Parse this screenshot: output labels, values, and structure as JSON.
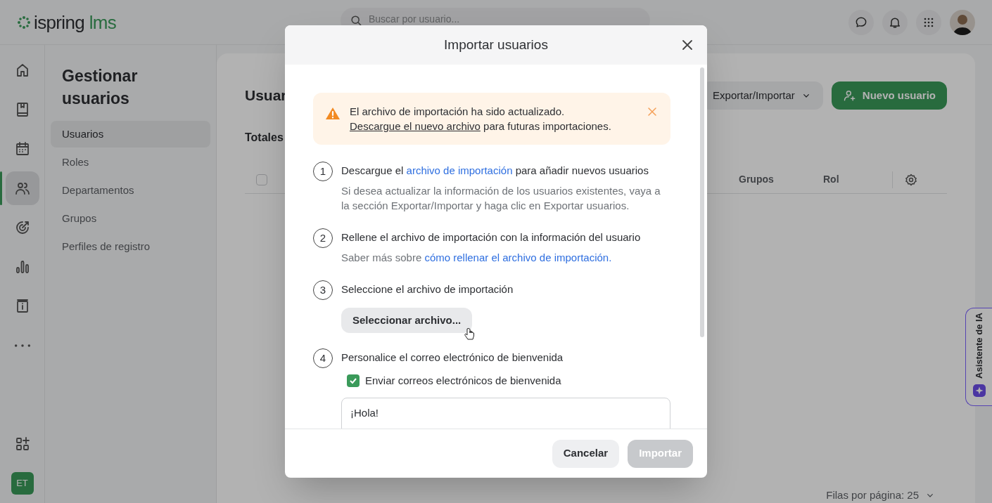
{
  "header": {
    "logo_left": "ispring",
    "logo_right": "lms",
    "search": {
      "placeholder": "Buscar por usuario..."
    }
  },
  "rail": {
    "items": [
      {
        "kind": "home",
        "selected": false
      },
      {
        "kind": "book",
        "selected": false
      },
      {
        "kind": "calendar",
        "selected": false
      },
      {
        "kind": "users",
        "selected": true
      },
      {
        "kind": "target",
        "selected": false
      },
      {
        "kind": "chart",
        "selected": false
      },
      {
        "kind": "info",
        "selected": false
      },
      {
        "kind": "more",
        "selected": false
      }
    ],
    "avatar": "ET"
  },
  "nav": {
    "title": "Gestionar usuarios",
    "items": [
      {
        "label": "Usuarios",
        "selected": true
      },
      {
        "label": "Roles",
        "selected": false
      },
      {
        "label": "Departamentos",
        "selected": false
      },
      {
        "label": "Grupos",
        "selected": false
      },
      {
        "label": "Perfiles de registro",
        "selected": false
      }
    ]
  },
  "main": {
    "title": "Usuar",
    "subtitle": "Totales",
    "export_button": "Exportar/Importar",
    "new_button": "Nuevo usuario",
    "select_all": {
      "checked": false
    },
    "columns": [
      "Grupos",
      "Rol"
    ],
    "rows_per_page": "Filas por página: 25"
  },
  "assistant": "Asistente de IA",
  "dialog": {
    "title": "Importar usuarios",
    "alert": {
      "text": "El archivo de importación ha sido actualizado.",
      "link": "Descargue el nuevo archivo",
      "after": "para futuras importaciones."
    },
    "steps": [
      {
        "number": "1",
        "before": "Descargue el",
        "link": "archivo de importación",
        "after": "para añadir nuevos usuarios",
        "note": "Si desea actualizar la información de los usuarios existentes, vaya a la sección Exportar/Importar y haga clic en Exportar usuarios."
      },
      {
        "number": "2",
        "before": "Rellene el archivo de importación con la información del usuario",
        "note_before": "Saber más sobre",
        "note_link": "cómo rellenar el archivo de importación."
      },
      {
        "number": "3",
        "before": "Seleccione el archivo de importación",
        "button": "Seleccionar archivo..."
      },
      {
        "number": "4",
        "before": "Personalice el correo electrónico de bienvenida",
        "checkbox": {
          "label": "Enviar correos electrónicos de bienvenida",
          "checked": true
        },
        "message": "¡Hola!"
      }
    ],
    "cancel": "Cancelar",
    "import": {
      "label": "Importar",
      "disabled": true
    }
  }
}
